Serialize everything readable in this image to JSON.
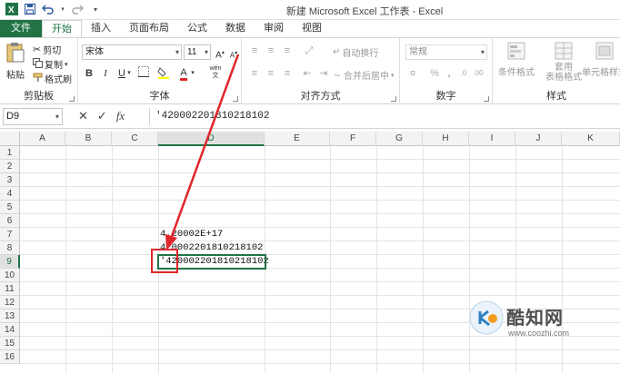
{
  "window": {
    "title": "新建 Microsoft Excel 工作表 - Excel"
  },
  "tabs": [
    {
      "label": "文件"
    },
    {
      "label": "开始"
    },
    {
      "label": "插入"
    },
    {
      "label": "页面布局"
    },
    {
      "label": "公式"
    },
    {
      "label": "数据"
    },
    {
      "label": "审阅"
    },
    {
      "label": "视图"
    }
  ],
  "ribbon": {
    "clipboard": {
      "paste_label": "粘贴",
      "cut_label": "剪切",
      "copy_label": "复制",
      "format_painter_label": "格式刷",
      "group_label": "剪贴板"
    },
    "font": {
      "font_name": "宋体",
      "font_size": "11",
      "bold": "B",
      "italic": "I",
      "underline": "U",
      "font_color_glyph": "A",
      "wen": "wén",
      "group_label": "字体"
    },
    "alignment": {
      "wrap_text_label": "自动换行",
      "merge_center_label": "合并后居中",
      "group_label": "对齐方式"
    },
    "number": {
      "format_value": "常规",
      "percent": "%",
      "comma": ",",
      "group_label": "数字"
    },
    "styles": {
      "conditional_format_label": "条件格式",
      "table_format_line1": "套用",
      "table_format_line2": "表格格式",
      "cell_styles_label": "单元格样式",
      "group_label": "样式"
    }
  },
  "formula_bar": {
    "name_box": "D9",
    "formula": "'420002201810218102"
  },
  "grid": {
    "columns": [
      "A",
      "B",
      "C",
      "D",
      "E",
      "F",
      "G",
      "H",
      "I",
      "J",
      "K"
    ],
    "rows": [
      "1",
      "2",
      "3",
      "4",
      "5",
      "6",
      "7",
      "8",
      "9",
      "10",
      "11",
      "12",
      "13",
      "14",
      "15",
      "16"
    ],
    "selected_column": "D",
    "selected_row": "9",
    "cells": {
      "D7": "4.20002E+17",
      "D8": "420002201810218102",
      "D9": "'420002201810218102"
    }
  },
  "watermark": {
    "name": "酷知网",
    "url": "www.coozhi.com"
  },
  "colors": {
    "excel_green": "#217346",
    "annotation_red": "#e0262a"
  }
}
